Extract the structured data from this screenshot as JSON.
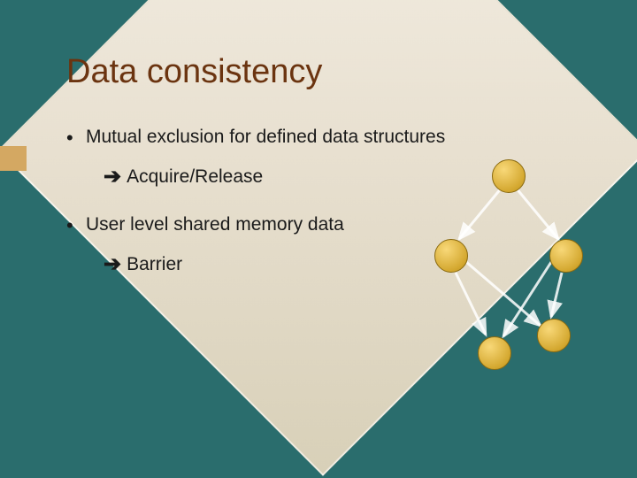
{
  "title": "Data consistency",
  "bullets": [
    {
      "text": "Mutual exclusion for defined data structures",
      "sub": {
        "arrow": "➔",
        "text": "Acquire/Release"
      }
    },
    {
      "text": "User level shared memory data",
      "sub": {
        "arrow": "➔",
        "text": "Barrier"
      }
    }
  ]
}
